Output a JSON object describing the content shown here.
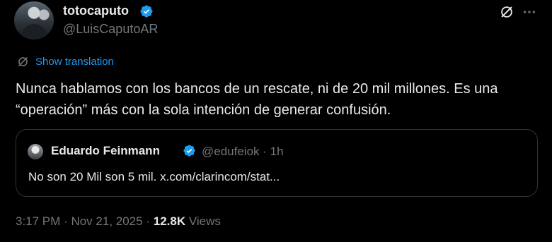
{
  "author": {
    "display_name": "totocaputo",
    "handle": "@LuisCaputoAR"
  },
  "translation": {
    "label": "Show translation"
  },
  "tweet": {
    "text": "Nunca hablamos con los bancos de un rescate, ni de 20 mil millones. Es una “operación” más con la sola intención de generar confusión."
  },
  "quote": {
    "display_name": "Eduardo Feinmann",
    "handle": "@edufeiok",
    "separator": "·",
    "time": "1h",
    "text": "No son 20 Mil son 5 mil. x.com/clarincom/stat..."
  },
  "meta": {
    "time": "3:17 PM",
    "separator1": "·",
    "date": "Nov 21, 2025",
    "separator2": "·",
    "views_count": "12.8K",
    "views_label": "Views"
  },
  "colors": {
    "accent": "#1d9bf0",
    "muted": "#71767b",
    "text": "#e7e9ea",
    "background": "#000000"
  },
  "icons": [
    "verified-badge-icon",
    "grok-icon",
    "more-icon",
    "translate-icon"
  ]
}
